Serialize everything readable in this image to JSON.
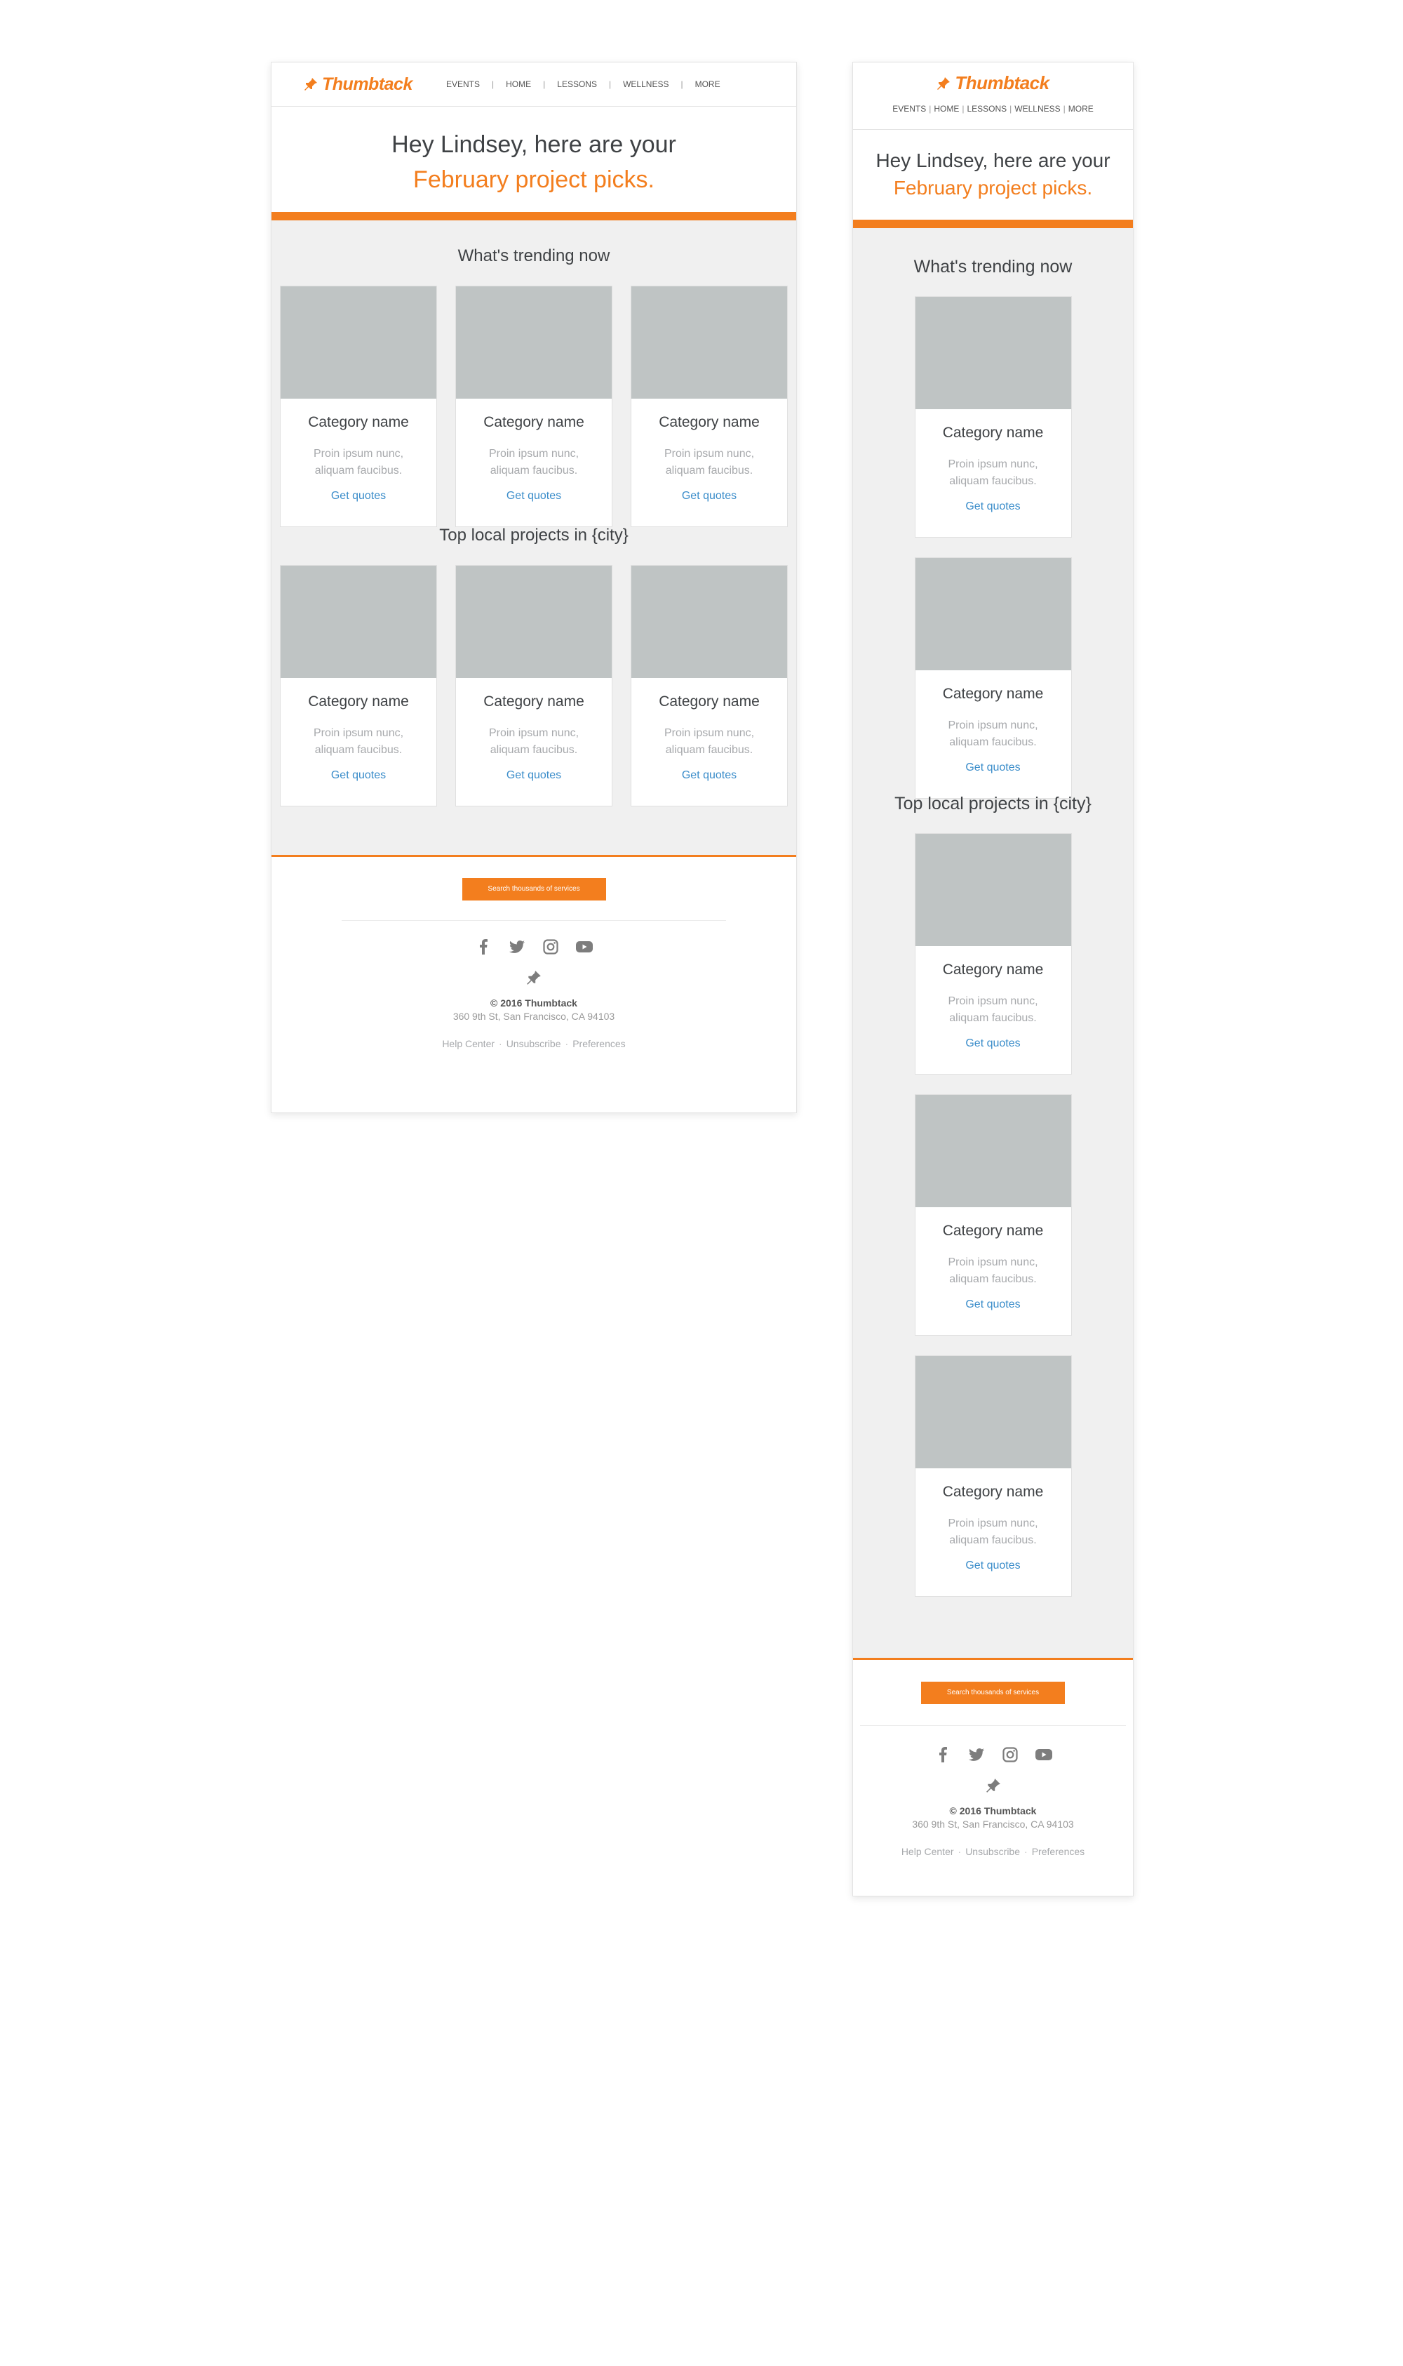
{
  "brand": {
    "logo_text": "Thumbtack",
    "accent": "#f37e1e",
    "link_color": "#3b8dca"
  },
  "nav": [
    "EVENTS",
    "HOME",
    "LESSONS",
    "WELLNESS",
    "MORE"
  ],
  "nav_separator": "|",
  "hero": {
    "line1": "Hey Lindsey, here are your",
    "line2": "February project picks."
  },
  "sections": [
    {
      "title": "What's trending now",
      "cards": [
        {
          "name": "Category name",
          "desc_line1": "Proin ipsum nunc,",
          "desc_line2": "aliquam faucibus.",
          "cta": "Get quotes"
        },
        {
          "name": "Category name",
          "desc_line1": "Proin ipsum nunc,",
          "desc_line2": "aliquam faucibus.",
          "cta": "Get quotes"
        },
        {
          "name": "Category name",
          "desc_line1": "Proin ipsum nunc,",
          "desc_line2": "aliquam faucibus.",
          "cta": "Get quotes"
        }
      ]
    },
    {
      "title": "Top local projects in {city}",
      "cards": [
        {
          "name": "Category name",
          "desc_line1": "Proin ipsum nunc,",
          "desc_line2": "aliquam faucibus.",
          "cta": "Get quotes"
        },
        {
          "name": "Category name",
          "desc_line1": "Proin ipsum nunc,",
          "desc_line2": "aliquam faucibus.",
          "cta": "Get quotes"
        },
        {
          "name": "Category name",
          "desc_line1": "Proin ipsum nunc,",
          "desc_line2": "aliquam faucibus.",
          "cta": "Get quotes"
        }
      ]
    }
  ],
  "mobile_sections": [
    {
      "title": "What's trending now",
      "card_count": 2
    },
    {
      "title": "Top local projects in {city}",
      "card_count": 3
    }
  ],
  "footer": {
    "button": "Search thousands of services",
    "social_icons": [
      "facebook-icon",
      "twitter-icon",
      "instagram-icon",
      "youtube-icon"
    ],
    "copyright": "© 2016 Thumbtack",
    "address": "360 9th St, San Francisco, CA 94103",
    "links": [
      "Help Center",
      "Unsubscribe",
      "Preferences"
    ],
    "link_separator": "·"
  }
}
